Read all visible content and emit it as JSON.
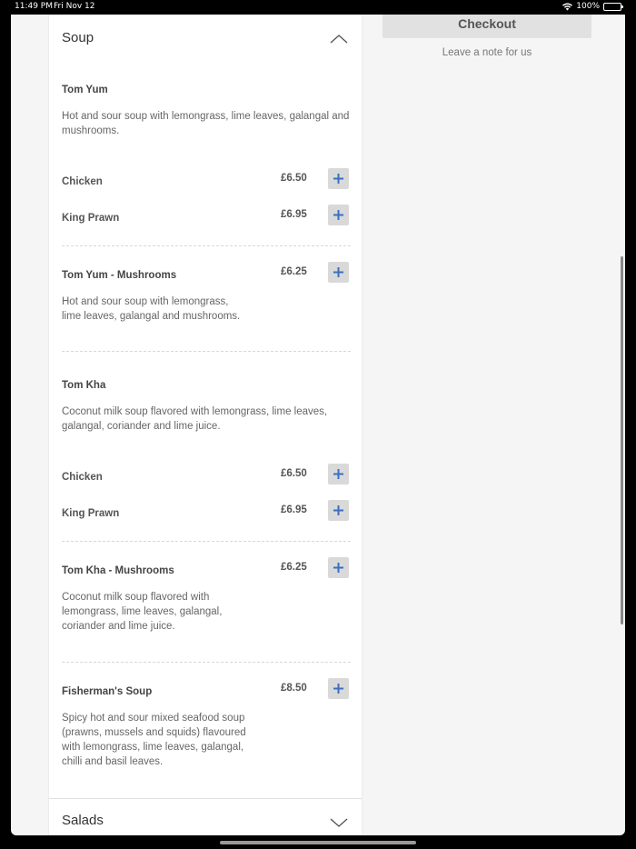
{
  "status": {
    "time": "11:49 PM",
    "date": "Fri Nov 12",
    "battery": "100%"
  },
  "sidebar": {
    "checkout_label": "Checkout",
    "note_label": "Leave a note for us"
  },
  "menu": {
    "soup_title": "Soup",
    "salads_title": "Salads",
    "add_icon": "plus-icon",
    "items": [
      {
        "name": "Tom Yum",
        "description": "Hot and sour soup with lemongrass, lime leaves, galangal and mushrooms.",
        "variants": [
          {
            "name": "Chicken",
            "price": "£6.50"
          },
          {
            "name": "King Prawn",
            "price": "£6.95"
          }
        ]
      },
      {
        "name": "Tom Yum - Mushrooms",
        "price": "£6.25",
        "description": "Hot and sour soup with lemongrass, lime leaves, galangal and mushrooms."
      },
      {
        "name": "Tom Kha",
        "description": "Coconut milk soup flavored with lemongrass, lime leaves, galangal, coriander and lime juice.",
        "variants": [
          {
            "name": "Chicken",
            "price": "£6.50"
          },
          {
            "name": "King Prawn",
            "price": "£6.95"
          }
        ]
      },
      {
        "name": "Tom Kha - Mushrooms",
        "price": "£6.25",
        "description": "Coconut milk soup flavored with lemongrass, lime leaves, galangal, coriander and lime juice."
      },
      {
        "name": "Fisherman's Soup",
        "price": "£8.50",
        "description": "Spicy hot and sour mixed seafood soup (prawns, mussels and squids) flavoured with lemongrass, lime leaves, galangal, chilli and basil leaves."
      }
    ]
  },
  "colors": {
    "accent": "#3a6fc2",
    "button_bg": "#d9d9d9"
  }
}
